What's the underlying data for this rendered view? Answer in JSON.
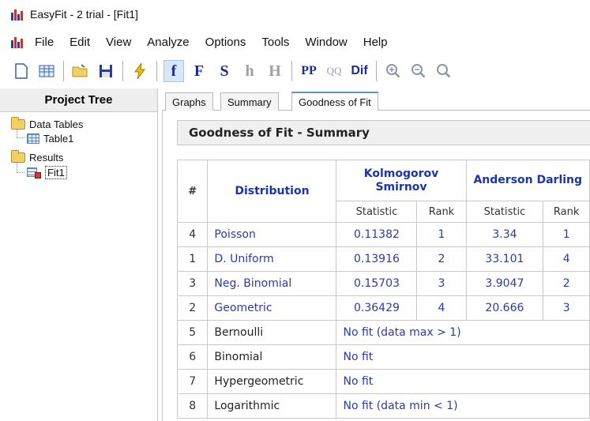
{
  "window": {
    "title": "EasyFit - 2 trial - [Fit1]"
  },
  "menu": [
    "File",
    "Edit",
    "View",
    "Analyze",
    "Options",
    "Tools",
    "Window",
    "Help"
  ],
  "toolbar": {
    "letters": {
      "f": "f",
      "F": "F",
      "S": "S",
      "h": "h",
      "H": "H",
      "PP": "PP",
      "QQ": "QQ",
      "Dif": "Dif"
    },
    "icons": [
      "new-document-icon",
      "table-icon",
      "open-folder-icon",
      "save-icon",
      "lightning-icon",
      "zoom-in-icon",
      "zoom-out-icon",
      "zoom-reset-icon"
    ]
  },
  "sidebar": {
    "title": "Project Tree",
    "nodes": [
      {
        "label": "Data Tables",
        "icon": "folder-icon"
      },
      {
        "label": "Table1",
        "icon": "table-icon"
      },
      {
        "label": "Results",
        "icon": "folder-icon"
      },
      {
        "label": "Fit1",
        "icon": "fit-result-icon"
      }
    ]
  },
  "tabs": [
    {
      "label": "Graphs",
      "active": false
    },
    {
      "label": "Summary",
      "active": false
    },
    {
      "label": "Goodness of Fit",
      "active": true
    }
  ],
  "panel": {
    "title": "Goodness of Fit - Summary",
    "columns": {
      "num": "#",
      "distribution": "Distribution",
      "ks": "Kolmogorov Smirnov",
      "ad": "Anderson Darling",
      "statistic": "Statistic",
      "rank": "Rank"
    },
    "rows": [
      {
        "num": "4",
        "dist": "Poisson",
        "ks_stat": "0.11382",
        "ks_rank": "1",
        "ad_stat": "3.34",
        "ad_rank": "1"
      },
      {
        "num": "1",
        "dist": "D. Uniform",
        "ks_stat": "0.13916",
        "ks_rank": "2",
        "ad_stat": "33.101",
        "ad_rank": "4"
      },
      {
        "num": "3",
        "dist": "Neg. Binomial",
        "ks_stat": "0.15703",
        "ks_rank": "3",
        "ad_stat": "3.9047",
        "ad_rank": "2"
      },
      {
        "num": "2",
        "dist": "Geometric",
        "ks_stat": "0.36429",
        "ks_rank": "4",
        "ad_stat": "20.666",
        "ad_rank": "3"
      },
      {
        "num": "5",
        "dist": "Bernoulli",
        "nofit": "No fit  (data max > 1)"
      },
      {
        "num": "6",
        "dist": "Binomial",
        "nofit": "No fit"
      },
      {
        "num": "7",
        "dist": "Hypergeometric",
        "nofit": "No fit"
      },
      {
        "num": "8",
        "dist": "Logarithmic",
        "nofit": "No fit  (data min < 1)"
      }
    ]
  },
  "colors": {
    "accent": "#1a34b0",
    "link": "#2c3aa8",
    "tab_highlight": "#5b8fd0"
  }
}
